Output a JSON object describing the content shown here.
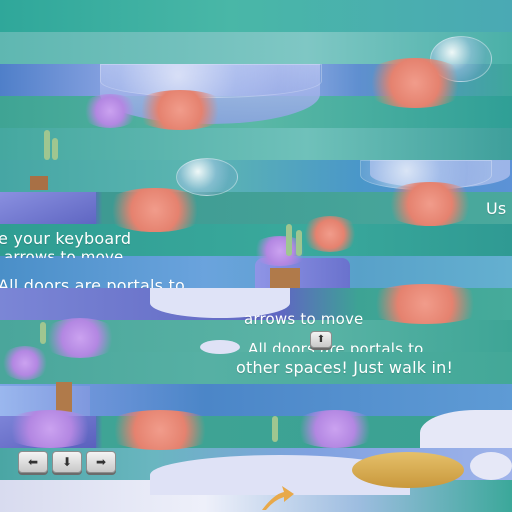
{
  "colors": {
    "sky": "#3fae9f",
    "floor": "#8ea2e2",
    "pink_plant": "#e5826f",
    "purple_plant": "#b387e2",
    "wall": "#6d74cf",
    "text": "#ffffff"
  },
  "instructions": {
    "use_keyboard": "e your keyboard",
    "arrows_to_move_top": "arrows to move",
    "doors_portals_top": "All doors are portals to",
    "arrows_to_move": "arrows to move",
    "doors_portals": "All doors are portals to",
    "other_spaces": "other spaces! Just walk in!",
    "right_edge_fragment": "Us"
  },
  "keys": {
    "up": "⬆",
    "left": "⬅",
    "down": "⬇",
    "right": "➡"
  },
  "icons": [
    "up-arrow-key-icon",
    "left-arrow-key-icon",
    "down-arrow-key-icon",
    "right-arrow-key-icon",
    "bubble-icon",
    "plant-icon"
  ]
}
